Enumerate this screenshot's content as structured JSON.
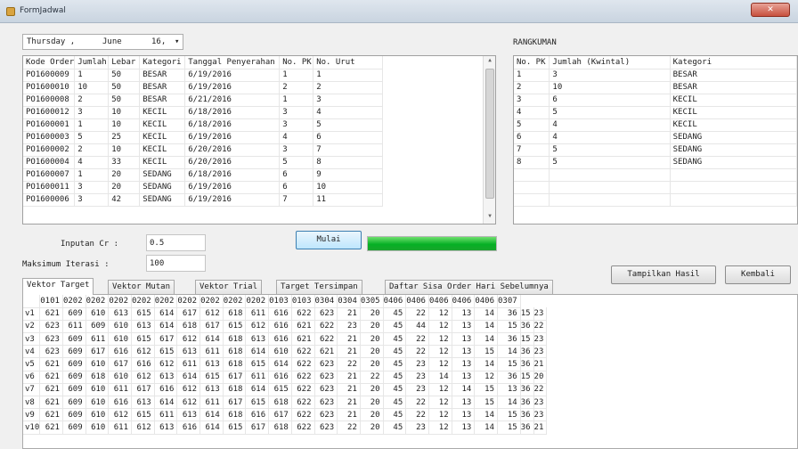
{
  "window": {
    "title": "FormJadwal",
    "close_label": "✕"
  },
  "datepicker": {
    "day": "Thursday ,",
    "month": "June",
    "date": "16,",
    "arrow": "▾"
  },
  "orders": {
    "columns": [
      "Kode Order",
      "Jumlah",
      "Lebar",
      "Kategori",
      "Tanggal Penyerahan",
      "No. PK",
      "No. Urut"
    ],
    "rows": [
      [
        "PO1600009",
        "1",
        "50",
        "BESAR",
        "6/19/2016",
        "1",
        "1"
      ],
      [
        "PO1600010",
        "10",
        "50",
        "BESAR",
        "6/19/2016",
        "2",
        "2"
      ],
      [
        "PO1600008",
        "2",
        "50",
        "BESAR",
        "6/21/2016",
        "1",
        "3"
      ],
      [
        "PO1600012",
        "3",
        "10",
        "KECIL",
        "6/18/2016",
        "3",
        "4"
      ],
      [
        "PO1600001",
        "1",
        "10",
        "KECIL",
        "6/18/2016",
        "3",
        "5"
      ],
      [
        "PO1600003",
        "5",
        "25",
        "KECIL",
        "6/19/2016",
        "4",
        "6"
      ],
      [
        "PO1600002",
        "2",
        "10",
        "KECIL",
        "6/20/2016",
        "3",
        "7"
      ],
      [
        "PO1600004",
        "4",
        "33",
        "KECIL",
        "6/20/2016",
        "5",
        "8"
      ],
      [
        "PO1600007",
        "1",
        "20",
        "SEDANG",
        "6/18/2016",
        "6",
        "9"
      ],
      [
        "PO1600011",
        "3",
        "20",
        "SEDANG",
        "6/19/2016",
        "6",
        "10"
      ],
      [
        "PO1600006",
        "3",
        "42",
        "SEDANG",
        "6/19/2016",
        "7",
        "11"
      ]
    ]
  },
  "rangkuman": {
    "label": "RANGKUMAN",
    "columns": [
      "No. PK",
      "Jumlah (Kwintal)",
      "Kategori"
    ],
    "rows": [
      [
        "1",
        "3",
        "BESAR"
      ],
      [
        "2",
        "10",
        "BESAR"
      ],
      [
        "3",
        "6",
        "KECIL"
      ],
      [
        "4",
        "5",
        "KECIL"
      ],
      [
        "5",
        "4",
        "KECIL"
      ],
      [
        "6",
        "4",
        "SEDANG"
      ],
      [
        "7",
        "5",
        "SEDANG"
      ],
      [
        "8",
        "5",
        "SEDANG"
      ]
    ]
  },
  "params": {
    "cr_label": "Inputan Cr :",
    "cr_value": "0.5",
    "iter_label": "Maksimum Iterasi :",
    "iter_value": "100"
  },
  "buttons": {
    "mulai": "Mulai",
    "tampilkan": "Tampilkan Hasil",
    "kembali": "Kembali"
  },
  "progress": {
    "value": 1.0,
    "color": "#06b025"
  },
  "tabs": [
    "Vektor Target",
    "Vektor Mutan",
    "Vektor Trial",
    "Target Tersimpan",
    "Daftar Sisa Order Hari Sebelumnya"
  ],
  "vektor": {
    "columns": [
      "",
      "0101",
      "0202",
      "0202",
      "0202",
      "0202",
      "0202",
      "0202",
      "0202",
      "0202",
      "0202",
      "0103",
      "0103",
      "0304",
      "0304",
      "0305",
      "0406",
      "0406",
      "0406",
      "0406",
      "0406",
      "0307"
    ],
    "rows": [
      [
        "v1",
        "621",
        "609",
        "610",
        "613",
        "615",
        "614",
        "617",
        "612",
        "618",
        "611",
        "616",
        "622",
        "623",
        "21",
        "20",
        "45",
        "22",
        "12",
        "13",
        "14",
        "36",
        "15",
        "23"
      ],
      [
        "v2",
        "623",
        "611",
        "609",
        "610",
        "613",
        "614",
        "618",
        "617",
        "615",
        "612",
        "616",
        "621",
        "622",
        "23",
        "20",
        "45",
        "44",
        "12",
        "13",
        "14",
        "15",
        "36",
        "22"
      ],
      [
        "v3",
        "623",
        "609",
        "611",
        "610",
        "615",
        "617",
        "612",
        "614",
        "618",
        "613",
        "616",
        "621",
        "622",
        "21",
        "20",
        "45",
        "22",
        "12",
        "13",
        "14",
        "36",
        "15",
        "23"
      ],
      [
        "v4",
        "623",
        "609",
        "617",
        "616",
        "612",
        "615",
        "613",
        "611",
        "618",
        "614",
        "610",
        "622",
        "621",
        "21",
        "20",
        "45",
        "22",
        "12",
        "13",
        "15",
        "14",
        "36",
        "23"
      ],
      [
        "v5",
        "621",
        "609",
        "610",
        "617",
        "616",
        "612",
        "611",
        "613",
        "618",
        "615",
        "614",
        "622",
        "623",
        "22",
        "20",
        "45",
        "23",
        "12",
        "13",
        "14",
        "15",
        "36",
        "21"
      ],
      [
        "v6",
        "621",
        "609",
        "618",
        "610",
        "612",
        "613",
        "614",
        "615",
        "617",
        "611",
        "616",
        "622",
        "623",
        "21",
        "22",
        "45",
        "23",
        "14",
        "13",
        "12",
        "36",
        "15",
        "20"
      ],
      [
        "v7",
        "621",
        "609",
        "610",
        "611",
        "617",
        "616",
        "612",
        "613",
        "618",
        "614",
        "615",
        "622",
        "623",
        "21",
        "20",
        "45",
        "23",
        "12",
        "14",
        "15",
        "13",
        "36",
        "22"
      ],
      [
        "v8",
        "621",
        "609",
        "610",
        "616",
        "613",
        "614",
        "612",
        "611",
        "617",
        "615",
        "618",
        "622",
        "623",
        "21",
        "20",
        "45",
        "22",
        "12",
        "13",
        "15",
        "14",
        "36",
        "23"
      ],
      [
        "v9",
        "621",
        "609",
        "610",
        "612",
        "615",
        "611",
        "613",
        "614",
        "618",
        "616",
        "617",
        "622",
        "623",
        "21",
        "20",
        "45",
        "22",
        "12",
        "13",
        "14",
        "15",
        "36",
        "23"
      ],
      [
        "v10",
        "621",
        "609",
        "610",
        "611",
        "612",
        "613",
        "616",
        "614",
        "615",
        "617",
        "618",
        "622",
        "623",
        "22",
        "20",
        "45",
        "23",
        "12",
        "13",
        "14",
        "15",
        "36",
        "21"
      ]
    ]
  }
}
